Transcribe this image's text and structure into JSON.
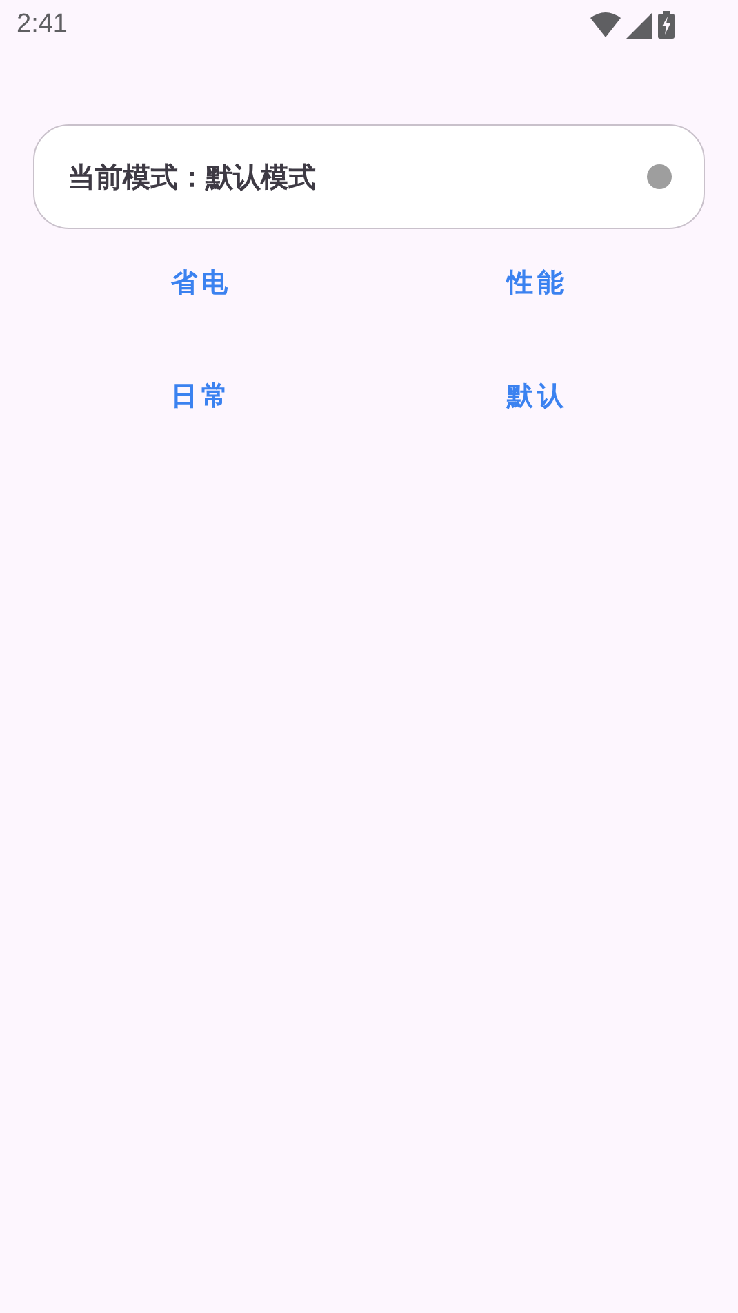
{
  "status_bar": {
    "time": "2:41"
  },
  "mode_card": {
    "text": "当前模式：默认模式",
    "color": "#9e9e9e"
  },
  "buttons": [
    {
      "label": "省电"
    },
    {
      "label": "性能"
    },
    {
      "label": "日常"
    },
    {
      "label": "默认"
    }
  ]
}
